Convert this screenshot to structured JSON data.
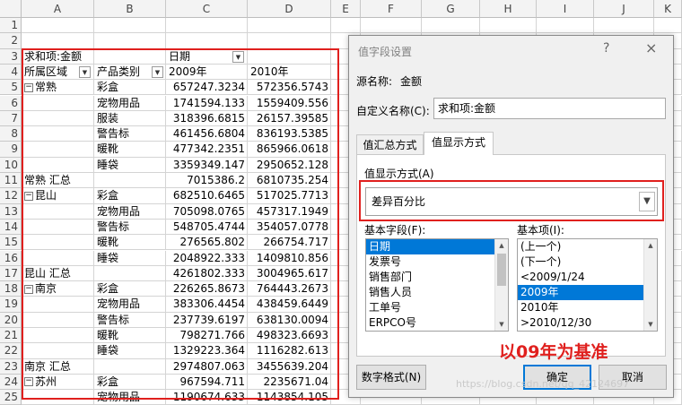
{
  "columns": [
    "A",
    "B",
    "C",
    "D",
    "E",
    "F",
    "G",
    "H",
    "I",
    "J",
    "K"
  ],
  "rows": [
    1,
    2,
    3,
    4,
    5,
    6,
    7,
    8,
    9,
    10,
    11,
    12,
    13,
    14,
    15,
    16,
    17,
    18,
    19,
    20,
    21,
    22,
    23,
    24,
    25
  ],
  "pivot": {
    "value_field": "求和项:金额",
    "col_field": "日期",
    "region_header": "所属区域",
    "category_header": "产品类别",
    "year_headers": [
      "2009年",
      "2010年"
    ],
    "rows": [
      {
        "r": 5,
        "region": "常熟",
        "category": "彩盒",
        "y2009": "657247.3234",
        "y2010": "572356.5743"
      },
      {
        "r": 6,
        "region": "",
        "category": "宠物用品",
        "y2009": "1741594.133",
        "y2010": "1559409.556"
      },
      {
        "r": 7,
        "region": "",
        "category": "服装",
        "y2009": "318396.6815",
        "y2010": "26157.39585"
      },
      {
        "r": 8,
        "region": "",
        "category": "警告标",
        "y2009": "461456.6804",
        "y2010": "836193.5385"
      },
      {
        "r": 9,
        "region": "",
        "category": "暖靴",
        "y2009": "477342.2351",
        "y2010": "865966.0618"
      },
      {
        "r": 10,
        "region": "",
        "category": "睡袋",
        "y2009": "3359349.147",
        "y2010": "2950652.128"
      },
      {
        "r": 11,
        "region": "常熟 汇总",
        "category": "",
        "y2009": "7015386.2",
        "y2010": "6810735.254",
        "total": true
      },
      {
        "r": 12,
        "region": "昆山",
        "category": "彩盒",
        "y2009": "682510.6465",
        "y2010": "517025.7713"
      },
      {
        "r": 13,
        "region": "",
        "category": "宠物用品",
        "y2009": "705098.0765",
        "y2010": "457317.1949"
      },
      {
        "r": 14,
        "region": "",
        "category": "警告标",
        "y2009": "548705.4744",
        "y2010": "354057.0778"
      },
      {
        "r": 15,
        "region": "",
        "category": "暖靴",
        "y2009": "276565.802",
        "y2010": "266754.717"
      },
      {
        "r": 16,
        "region": "",
        "category": "睡袋",
        "y2009": "2048922.333",
        "y2010": "1409810.856"
      },
      {
        "r": 17,
        "region": "昆山 汇总",
        "category": "",
        "y2009": "4261802.333",
        "y2010": "3004965.617",
        "total": true
      },
      {
        "r": 18,
        "region": "南京",
        "category": "彩盒",
        "y2009": "226265.8673",
        "y2010": "764443.2673"
      },
      {
        "r": 19,
        "region": "",
        "category": "宠物用品",
        "y2009": "383306.4454",
        "y2010": "438459.6449"
      },
      {
        "r": 20,
        "region": "",
        "category": "警告标",
        "y2009": "237739.6197",
        "y2010": "638130.0094"
      },
      {
        "r": 21,
        "region": "",
        "category": "暖靴",
        "y2009": "798271.766",
        "y2010": "498323.6693"
      },
      {
        "r": 22,
        "region": "",
        "category": "睡袋",
        "y2009": "1329223.364",
        "y2010": "1116282.613"
      },
      {
        "r": 23,
        "region": "南京 汇总",
        "category": "",
        "y2009": "2974807.063",
        "y2010": "3455639.204",
        "total": true
      },
      {
        "r": 24,
        "region": "苏州",
        "category": "彩盒",
        "y2009": "967594.711",
        "y2010": "2235671.04"
      },
      {
        "r": 25,
        "region": "",
        "category": "宠物用品",
        "y2009": "1190674.633",
        "y2010": "1143854.105"
      }
    ]
  },
  "dialog": {
    "title": "值字段设置",
    "help": "?",
    "close": "×",
    "source_label": "源名称:",
    "source_value": "金额",
    "custom_name_label": "自定义名称(C):",
    "custom_name_value": "求和项:金额",
    "tabs": [
      "值汇总方式",
      "值显示方式"
    ],
    "show_as_label": "值显示方式(A)",
    "show_as_value": "差异百分比",
    "base_field_label": "基本字段(F):",
    "base_fields": [
      "日期",
      "发票号",
      "销售部门",
      "销售人员",
      "工单号",
      "ERPCO号"
    ],
    "base_field_selected": "日期",
    "base_item_label": "基本项(I):",
    "base_items": [
      "(上一个)",
      "(下一个)",
      "<2009/1/24",
      "2009年",
      "2010年",
      ">2010/12/30"
    ],
    "base_item_selected": "2009年",
    "number_format_button": "数字格式(N)",
    "ok_button": "确定",
    "cancel_button": "取消"
  },
  "annotation": "以09年为基准",
  "watermark": "https://blog.csdn.net/qq_42124697",
  "colors": {
    "highlight": "#e0201e",
    "selection": "#0078d7"
  }
}
